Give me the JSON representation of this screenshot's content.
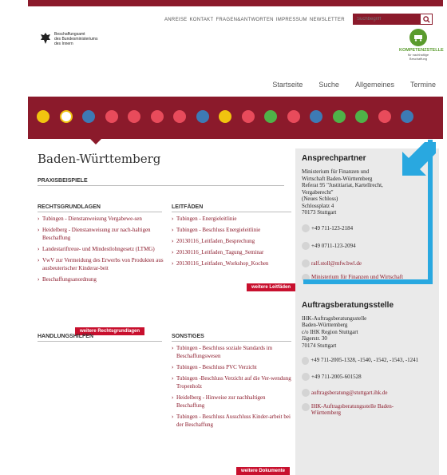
{
  "topnav": [
    "ANREISE",
    "KONTAKT",
    "FRAGEN&ANTWORTEN",
    "IMPRESSUM",
    "NEWSLETTER"
  ],
  "search": {
    "placeholder": "Suchbegriff"
  },
  "logo": {
    "line1": "Beschaffungsamt",
    "line2": "des Bundesministeriums",
    "line3": "des Innern"
  },
  "kompetenz": {
    "title": "KOMPETENZSTELLE",
    "subtitle": "für nachhaltige Beschaffung"
  },
  "mainnav": [
    "Startseite",
    "Suche",
    "Allgemeines",
    "Termine"
  ],
  "states": [
    {
      "name": "germany",
      "color": "#f1c40f"
    },
    {
      "name": "baden-wuerttemberg",
      "color": "#f1c40f",
      "active": true
    },
    {
      "name": "bayern",
      "color": "#3d7ab5"
    },
    {
      "name": "berlin",
      "color": "#e84b5b"
    },
    {
      "name": "brandenburg",
      "color": "#e84b5b"
    },
    {
      "name": "bremen",
      "color": "#e84b5b"
    },
    {
      "name": "hamburg",
      "color": "#e84b5b"
    },
    {
      "name": "hessen",
      "color": "#3d7ab5"
    },
    {
      "name": "mecklenburg-vorpommern",
      "color": "#f1c40f"
    },
    {
      "name": "niedersachsen",
      "color": "#e84b5b"
    },
    {
      "name": "nordrhein-westfalen",
      "color": "#4fb248"
    },
    {
      "name": "rheinland-pfalz",
      "color": "#e84b5b"
    },
    {
      "name": "saarland",
      "color": "#3d7ab5"
    },
    {
      "name": "sachsen",
      "color": "#4fb248"
    },
    {
      "name": "sachsen-anhalt",
      "color": "#4fb248"
    },
    {
      "name": "schleswig-holstein",
      "color": "#e84b5b"
    },
    {
      "name": "thueringen",
      "color": "#3d7ab5"
    }
  ],
  "title": "Baden-Württemberg",
  "praxis": {
    "heading": "PRAXISBEISPIELE"
  },
  "rechts": {
    "heading": "RECHTSGRUNDLAGEN",
    "items": [
      "Tubingen - Dienstanweisung Vergabewe-sen",
      "Heidelberg - Dienstanweisung zur nach-haltigen Beschaffung",
      "Landestariftreue- und Mindestlohngesetz (LTMG)",
      "VwV zur Vermeidung des Erwerbs von Produkten aus ausbeuterischer Kinderar-beit",
      "Beschaffungsanordnung"
    ],
    "more": "weitere Rechtsgrundlagen"
  },
  "leit": {
    "heading": "LEITFÄDEN",
    "items": [
      "Tubingen - Energieleitlinie",
      "Tubingen - Beschluss Energieleitlinie",
      "20130116_Leitfaden_Besprechung",
      "20130116_Leitfaden_Tagung_Seminar",
      "20130116_Leitfaden_Workshop_Kochen"
    ],
    "more": "weitere Leitfäden"
  },
  "hilfen": {
    "heading": "HANDLUNGSHILFEN"
  },
  "sonst": {
    "heading": "SONSTIGES",
    "items": [
      "Tubingen - Beschluss soziale Standards im Beschaffungswesen",
      "Tubingen - Beschluss PVC Verzicht",
      "Tubingen -Beschluss Verzicht auf die Ver-wendung Tropenholz",
      "Heidelberg - Hinweise zur nachhaltigen Beschaffung",
      "Tubingen - Beschluss Ausschluss Kinder-arbeit bei der Beschaffung"
    ],
    "more": "weitere Dokumente"
  },
  "ansprech": {
    "heading": "Ansprechpartner",
    "address": [
      "Ministerium für Finanzen und",
      "Wirtschaft Baden-Württemberg",
      "Referat 95 \"Justitiariat, Kartellrecht,",
      "Vergaberecht\"",
      "(Neues Schloss)",
      "Schlossplatz 4",
      "70173 Stuttgart"
    ],
    "phone": "+49 711-123-2184",
    "fax": "+49 0711-123-2094",
    "email": "ralf.stoll@mfw.bwl.de",
    "web": "Ministerium für Finanzen und Wirtschaft"
  },
  "auftrags": {
    "heading": "Auftragsberatungsstelle",
    "address": [
      "IHK-Auftragsberatungsstelle",
      "Baden-Württemberg",
      "c/o IHK Region Stuttgart",
      "Jägerstr. 30",
      "70174 Stuttgart"
    ],
    "phone": "+49 711-2005-1328, -1540, -1542, -1543, -1241",
    "fax": "+49 711-2005-601528",
    "email": "auftragsberatung@stuttgart.ihk.de",
    "web": "IHK-Auftragsberatungsstelle Baden-Württemberg"
  }
}
